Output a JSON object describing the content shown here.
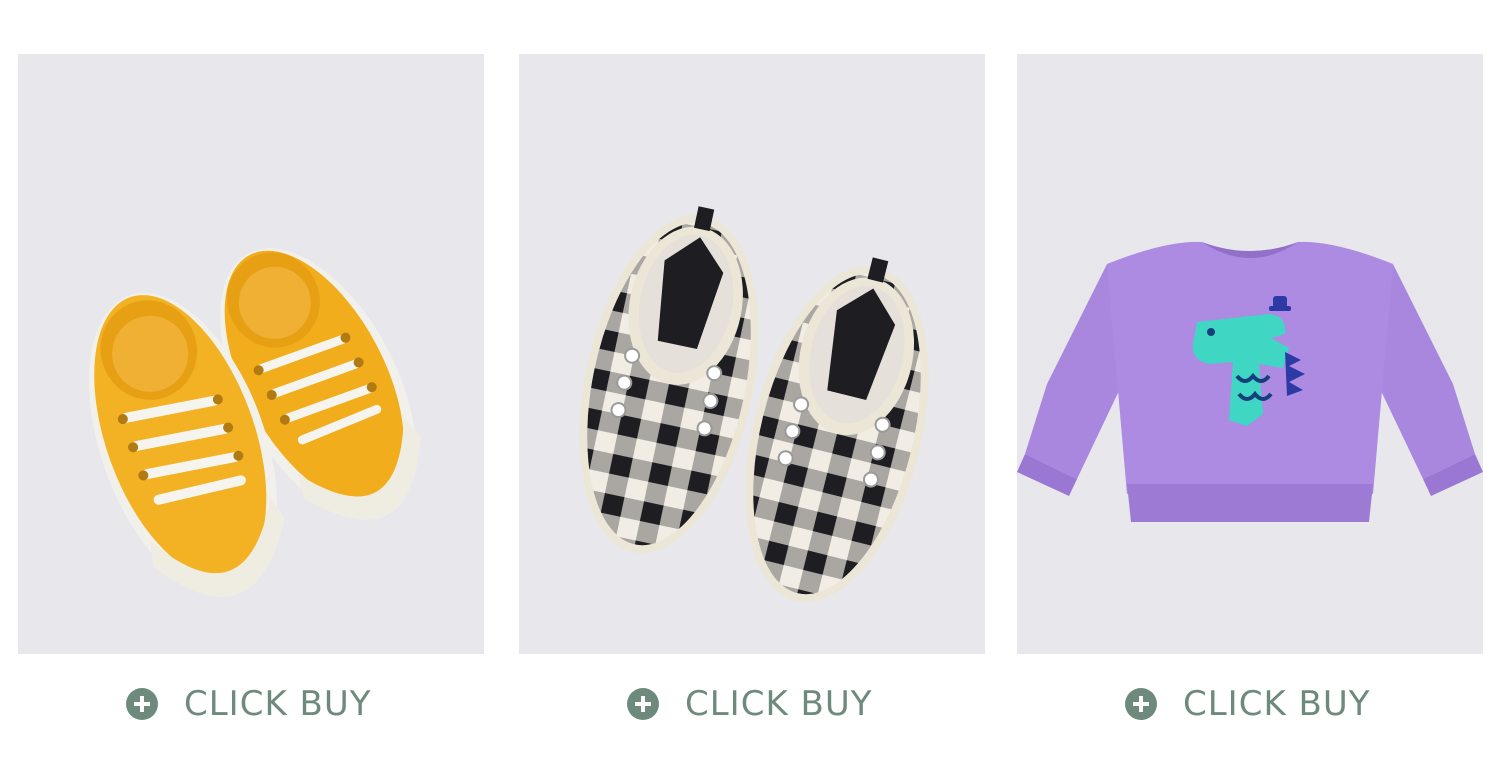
{
  "products": [
    {
      "product": "yellow-canvas-sneakers",
      "buy_label": "CLICK BUY"
    },
    {
      "product": "plaid-slip-on-shoes",
      "buy_label": "CLICK BUY"
    },
    {
      "product": "purple-dinosaur-sweatshirt",
      "buy_label": "CLICK BUY"
    }
  ],
  "colors": {
    "card_background": "#e7e7ec",
    "accent": "#6e8a7d",
    "page_background": "#ffffff"
  },
  "icons": {
    "buy_icon": "plus-circle-icon"
  }
}
